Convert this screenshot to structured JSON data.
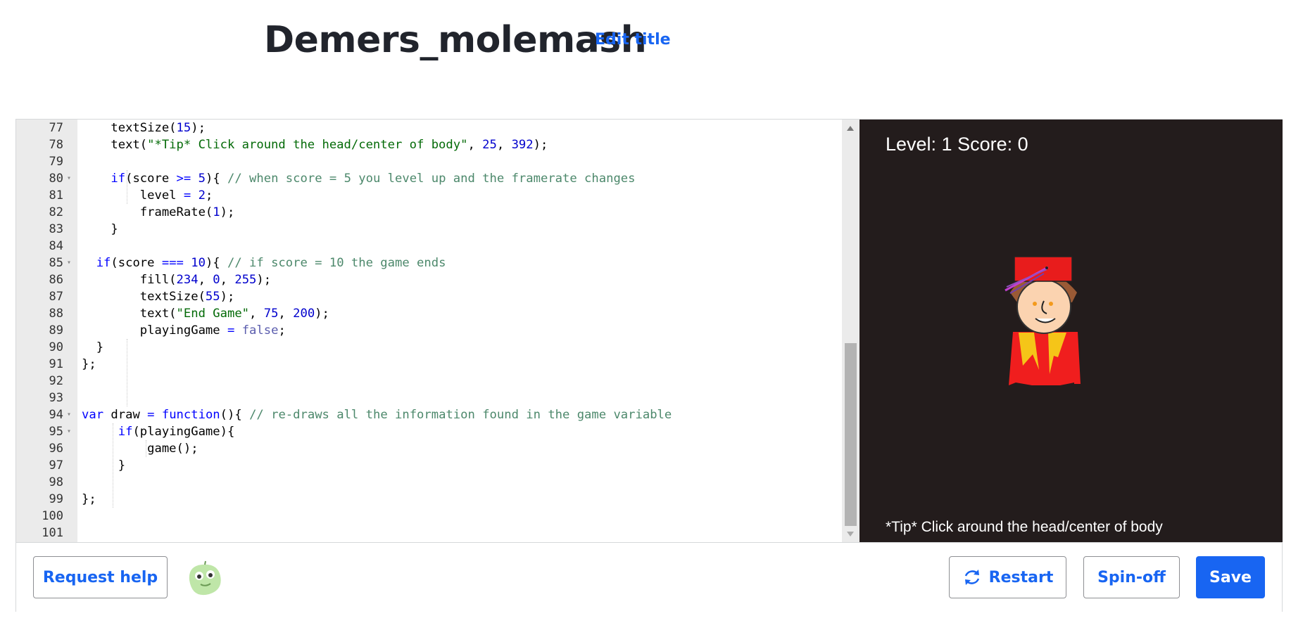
{
  "header": {
    "title": "Demers_molemash",
    "edit_title": "Edit title"
  },
  "editor": {
    "lines": [
      {
        "n": "77",
        "fold": false,
        "html": "    textSize(<span class='num'>15</span>);"
      },
      {
        "n": "78",
        "fold": false,
        "html": "    text(<span class='str'>\"*Tip* Click around the head/center of body\"</span>, <span class='num'>25</span>, <span class='num'>392</span>);"
      },
      {
        "n": "79",
        "fold": false,
        "html": ""
      },
      {
        "n": "80",
        "fold": true,
        "html": "    <span class='kw'>if</span>(score <span class='kw'>&gt;=</span> <span class='num'>5</span>){ <span class='cm'>// when score = 5 you level up and the framerate changes</span>"
      },
      {
        "n": "81",
        "fold": false,
        "html": "        level <span class='kw'>=</span> <span class='num'>2</span>;"
      },
      {
        "n": "82",
        "fold": false,
        "html": "        frameRate(<span class='num'>1</span>);"
      },
      {
        "n": "83",
        "fold": false,
        "html": "    }"
      },
      {
        "n": "84",
        "fold": false,
        "html": ""
      },
      {
        "n": "85",
        "fold": true,
        "html": "  <span class='kw'>if</span>(score <span class='kw'>===</span> <span class='num'>10</span>){ <span class='cm'>// if score = 10 the game ends</span>"
      },
      {
        "n": "86",
        "fold": false,
        "html": "        fill(<span class='num'>234</span>, <span class='num'>0</span>, <span class='num'>255</span>);"
      },
      {
        "n": "87",
        "fold": false,
        "html": "        textSize(<span class='num'>55</span>);"
      },
      {
        "n": "88",
        "fold": false,
        "html": "        text(<span class='str'>\"End Game\"</span>, <span class='num'>75</span>, <span class='num'>200</span>);"
      },
      {
        "n": "89",
        "fold": false,
        "html": "        playingGame <span class='kw'>=</span> <span class='bool'>false</span>;"
      },
      {
        "n": "90",
        "fold": false,
        "html": "  }"
      },
      {
        "n": "91",
        "fold": false,
        "html": "};"
      },
      {
        "n": "92",
        "fold": false,
        "html": ""
      },
      {
        "n": "93",
        "fold": false,
        "html": ""
      },
      {
        "n": "94",
        "fold": true,
        "html": "<span class='kw'>var</span> draw <span class='kw'>=</span> <span class='kw'>function</span>(){ <span class='cm'>// re-draws all the information found in the game variable</span>"
      },
      {
        "n": "95",
        "fold": true,
        "html": "     <span class='kw'>if</span>(playingGame){"
      },
      {
        "n": "96",
        "fold": false,
        "html": "         game();"
      },
      {
        "n": "97",
        "fold": false,
        "html": "     }"
      },
      {
        "n": "98",
        "fold": false,
        "html": ""
      },
      {
        "n": "99",
        "fold": false,
        "html": "};"
      },
      {
        "n": "100",
        "fold": false,
        "html": ""
      },
      {
        "n": "101",
        "fold": false,
        "html": ""
      }
    ]
  },
  "canvas": {
    "hud": "Level: 1  Score: 0",
    "tip": "*Tip* Click around the head/center of body",
    "background": "#231c1c"
  },
  "footer": {
    "request_help": "Request help",
    "restart": "Restart",
    "spin_off": "Spin-off",
    "save": "Save"
  },
  "colors": {
    "accent": "#1865f2",
    "editor_gutter": "#ebebeb"
  }
}
